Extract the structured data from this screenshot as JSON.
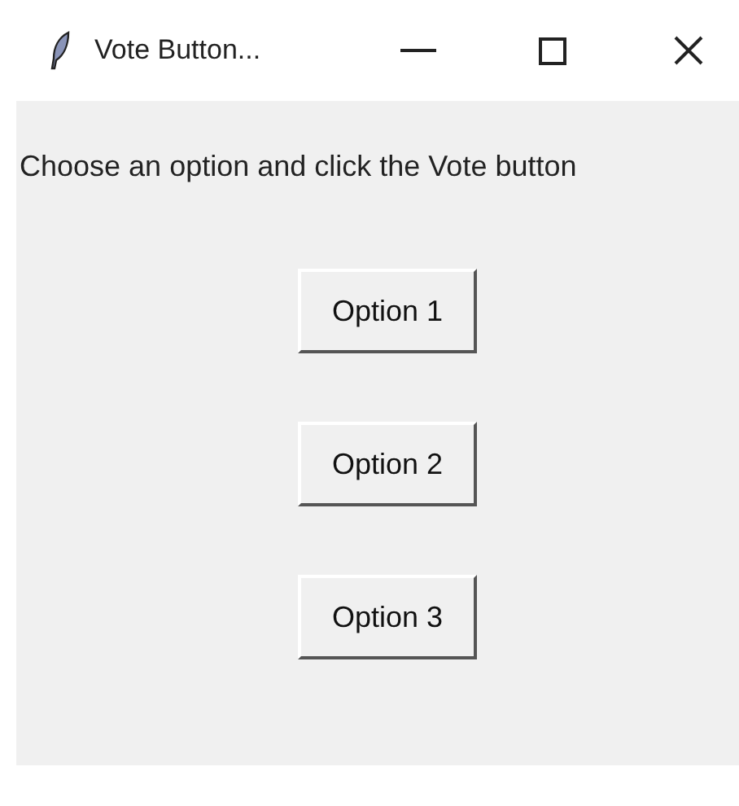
{
  "window": {
    "title": "Vote Button..."
  },
  "prompt": "Choose an option and click the Vote button",
  "buttons": [
    {
      "label": "Option 1"
    },
    {
      "label": "Option 2"
    },
    {
      "label": "Option 3"
    }
  ]
}
